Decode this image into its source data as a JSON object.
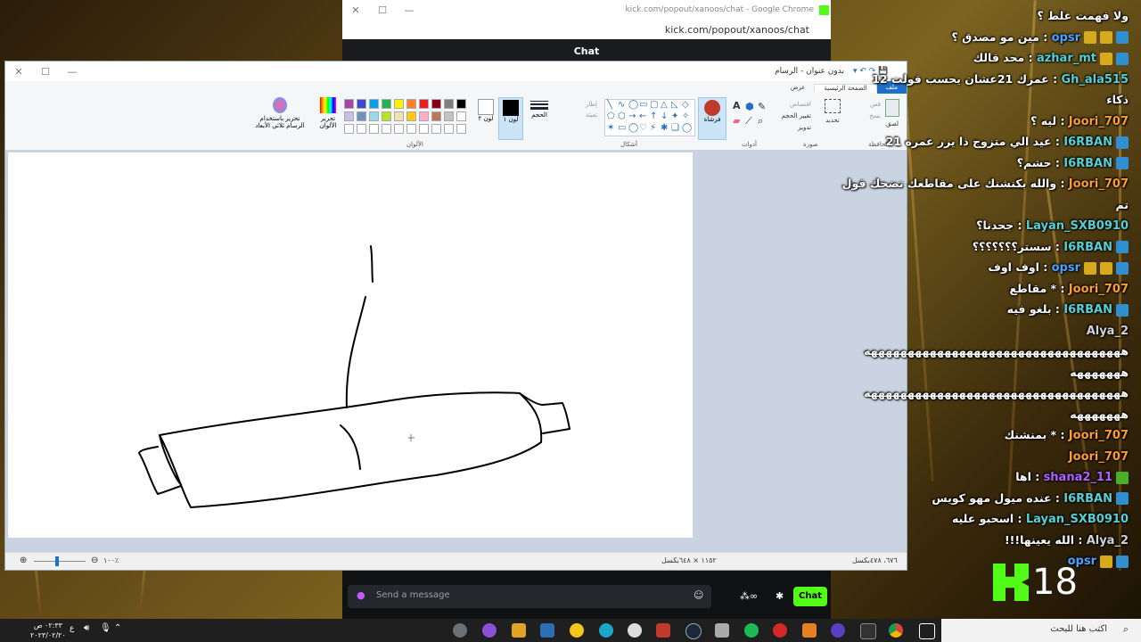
{
  "chrome": {
    "title": "kick.com/popout/xanoos/chat - Google Chrome",
    "url": "kick.com/popout/xanoos/chat",
    "header": "Chat",
    "input_placeholder": "Send a message",
    "chat_button": "Chat"
  },
  "paint": {
    "title": "بدون عنوان - الرسام",
    "tabs": [
      "ملف",
      "الصفحة الرئيسية",
      "عرض"
    ],
    "groups": {
      "clipboard": "الحافظة",
      "image": "صورة",
      "tools": "أدوات",
      "shapes": "أشكال",
      "colors": "الألوان"
    },
    "clipboard_items": [
      "قص",
      "نسخ",
      "لصق"
    ],
    "image_items": [
      "تحديد",
      "اقتصاص",
      "تغيير الحجم",
      "تدوير"
    ],
    "shapes_items": [
      "إطار",
      "تعبئة"
    ],
    "brush_label": "فرشاة",
    "size_label": "الحجم",
    "color1_label": "لون ١",
    "color2_label": "لون ٢",
    "edit_colors_label": "تحرير الألوان",
    "paint3d_label": "تحرير باستخدام الرسام ثلاثي الأبعاد",
    "status": {
      "zoom": "١٠٠٪",
      "image_size": "١١٥٢ × ٦٤٨بكسل",
      "cursor": "٦٧٦، ٤٧٨بكسل"
    },
    "palette": [
      "#000000",
      "#7f7f7f",
      "#880015",
      "#ed1c24",
      "#ff7f27",
      "#fff200",
      "#22b14c",
      "#00a2e8",
      "#3f48cc",
      "#a349a4",
      "#ffffff",
      "#c3c3c3",
      "#b97a57",
      "#ffaec9",
      "#ffc90e",
      "#efe4b0",
      "#b5e61d",
      "#99d9ea",
      "#7092be",
      "#c8bfe7"
    ]
  },
  "chat_messages": [
    {
      "name": "",
      "text": "ولا فهمت غلط ؟",
      "name_color": "#ffffff",
      "badges": []
    },
    {
      "name": "opsr",
      "text": "مين مو مصدق ؟",
      "name_color": "#4aa3ff",
      "badges": [
        "blue",
        "gold",
        "gold"
      ]
    },
    {
      "name": "azhar_mt",
      "text": "محد قالك",
      "name_color": "#53d1d6",
      "badges": [
        "blue",
        "gold"
      ]
    },
    {
      "name": "Gh_ala515",
      "text": "عمرك 21عشان يحسب قولت 12",
      "name_color": "#53d1d6",
      "badges": []
    },
    {
      "name": "",
      "text": "ذكاء",
      "name_color": "#ffffff",
      "badges": []
    },
    {
      "name": "Joori_707",
      "text": "ليه ؟",
      "name_color": "#ff9e2c",
      "badges": []
    },
    {
      "name": "I6RBAN",
      "text": "عيد الي متزوج ذا يزر عمره 21",
      "name_color": "#53d1d6",
      "badges": [
        "blue"
      ]
    },
    {
      "name": "I6RBAN",
      "text": "حشم؟",
      "name_color": "#53d1d6",
      "badges": [
        "blue"
      ]
    },
    {
      "name": "Joori_707",
      "text": "والله بكنشنك على مقاطعك تضحك قول",
      "name_color": "#ff9e2c",
      "badges": []
    },
    {
      "name": "",
      "text": "تم",
      "name_color": "#ffffff",
      "badges": []
    },
    {
      "name": "Layan_SXB0910",
      "text": "جحدنا؟",
      "name_color": "#53d1d6",
      "badges": []
    },
    {
      "name": "I6RBAN",
      "text": "سستر؟؟؟؟؟؟؟",
      "name_color": "#53d1d6",
      "badges": [
        "blue"
      ]
    },
    {
      "name": "opsr",
      "text": "اوف اوف",
      "name_color": "#4aa3ff",
      "badges": [
        "blue",
        "gold",
        "gold"
      ]
    },
    {
      "name": "Joori_707",
      "text": "* مقاطع",
      "name_color": "#ff9e2c",
      "badges": []
    },
    {
      "name": "I6RBAN",
      "text": "بلغو فيه",
      "name_color": "#53d1d6",
      "badges": [
        "blue"
      ]
    },
    {
      "name": "Alya_2",
      "text": "",
      "name_color": "#cfd3d6",
      "badges": []
    },
    {
      "name": "",
      "text": "هههههههههههههههههههههههههههههههههههه",
      "name_color": "#ffffff",
      "badges": []
    },
    {
      "name": "",
      "text": "هههههههه",
      "name_color": "#ffffff",
      "badges": []
    },
    {
      "name": "",
      "text": "هههههههههههههههههههههههههههههههههههه",
      "name_color": "#ffffff",
      "badges": []
    },
    {
      "name": "",
      "text": "هههههههه",
      "name_color": "#ffffff",
      "badges": []
    },
    {
      "name": "Joori_707",
      "text": "* بمنشنك",
      "name_color": "#ff9e2c",
      "badges": []
    },
    {
      "name": "Joori_707",
      "text": "",
      "name_color": "#ff9e2c",
      "badges": []
    },
    {
      "name": "shana2_11",
      "text": "اها",
      "name_color": "#b061ff",
      "badges": [
        "green"
      ]
    },
    {
      "name": "I6RBAN",
      "text": "عنده ميول مهو كويس",
      "name_color": "#53d1d6",
      "badges": [
        "blue"
      ]
    },
    {
      "name": "Layan_SXB0910",
      "text": "اسحبو عليه",
      "name_color": "#53d1d6",
      "badges": []
    },
    {
      "name": "Alya_2",
      "text": "الله يعينها!!!",
      "name_color": "#cfd3d6",
      "badges": []
    },
    {
      "name": "opsr",
      "text": "",
      "name_color": "#4aa3ff",
      "badges": [
        "blue",
        "gold"
      ]
    }
  ],
  "overlay_number": "18",
  "taskbar": {
    "search_placeholder": "اكتب هنا للبحث",
    "time": "٠٢:٣٣ ص",
    "date": "٢٠٢٣/٠٢/٢٠",
    "lang": "ع"
  }
}
